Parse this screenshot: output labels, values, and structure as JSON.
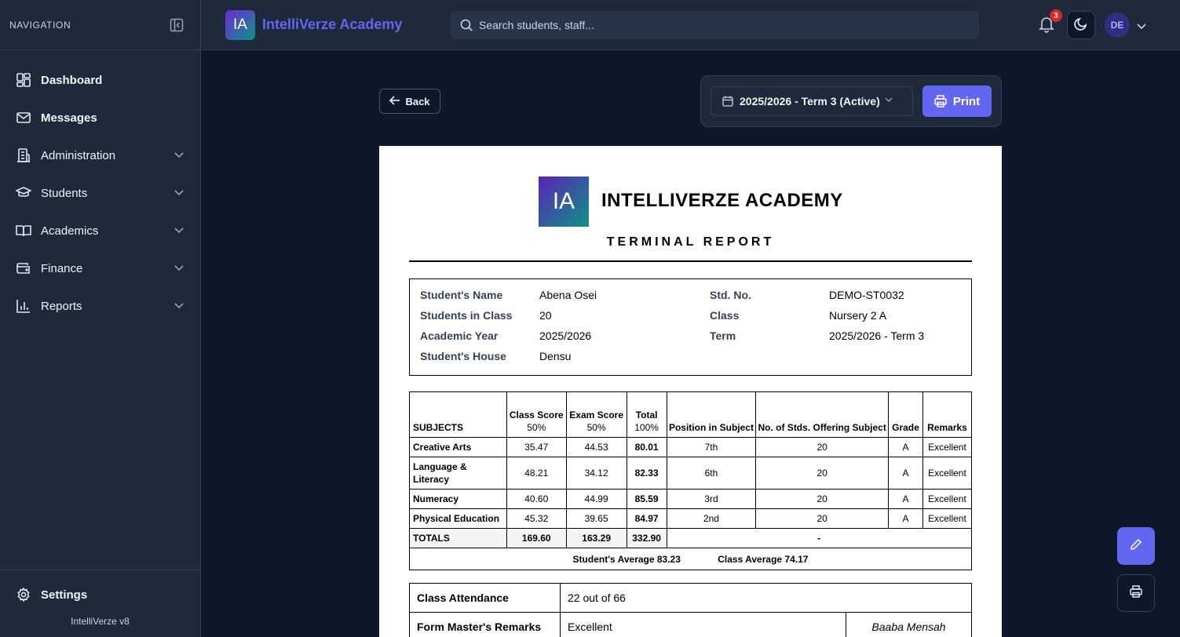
{
  "sidebar": {
    "nav_label": "NAVIGATION",
    "items": [
      {
        "label": "Dashboard",
        "icon": "dashboard-icon"
      },
      {
        "label": "Messages",
        "icon": "mail-icon"
      },
      {
        "label": "Administration",
        "icon": "building-icon"
      },
      {
        "label": "Students",
        "icon": "graduation-cap-icon"
      },
      {
        "label": "Academics",
        "icon": "book-icon"
      },
      {
        "label": "Finance",
        "icon": "wallet-icon"
      },
      {
        "label": "Reports",
        "icon": "bar-chart-icon"
      }
    ],
    "settings_label": "Settings",
    "version": "IntelliVerze v8"
  },
  "topbar": {
    "logo_text": "IA",
    "brand": "IntelliVerze Academy",
    "search_placeholder": "Search students, staff...",
    "notification_count": "3",
    "avatar_initials": "DE"
  },
  "toolbar": {
    "back_label": "Back",
    "term_selected": "2025/2026 - Term 3 (Active)",
    "print_label": "Print"
  },
  "report": {
    "logo_text": "IA",
    "school_name": "INTELLIVERZE ACADEMY",
    "title": "TERMINAL REPORT",
    "info": {
      "name_label": "Student's Name",
      "name_value": "Abena Osei",
      "stdno_label": "Std. No.",
      "stdno_value": "DEMO-ST0032",
      "inclass_label": "Students in Class",
      "inclass_value": "20",
      "class_label": "Class",
      "class_value": "Nursery 2 A",
      "year_label": "Academic Year",
      "year_value": "2025/2026",
      "term_label": "Term",
      "term_value": "2025/2026 - Term 3",
      "house_label": "Student's House",
      "house_value": "Densu"
    },
    "headers": {
      "subjects": "SUBJECTS",
      "class_score": "Class Score",
      "class_score_pct": "50%",
      "exam_score": "Exam Score",
      "exam_score_pct": "50%",
      "total": "Total",
      "total_pct": "100%",
      "position": "Position in Subject",
      "num_offering": "No. of Stds. Offering Subject",
      "grade": "Grade",
      "remarks": "Remarks"
    },
    "rows": [
      {
        "subject": "Creative Arts",
        "class": "35.47",
        "exam": "44.53",
        "total": "80.01",
        "position": "7th",
        "count": "20",
        "grade": "A",
        "remark": "Excellent"
      },
      {
        "subject": "Language & Literacy",
        "class": "48.21",
        "exam": "34.12",
        "total": "82.33",
        "position": "6th",
        "count": "20",
        "grade": "A",
        "remark": "Excellent"
      },
      {
        "subject": "Numeracy",
        "class": "40.60",
        "exam": "44.99",
        "total": "85.59",
        "position": "3rd",
        "count": "20",
        "grade": "A",
        "remark": "Excellent"
      },
      {
        "subject": "Physical Education",
        "class": "45.32",
        "exam": "39.65",
        "total": "84.97",
        "position": "2nd",
        "count": "20",
        "grade": "A",
        "remark": "Excellent"
      }
    ],
    "totals": {
      "label": "TOTALS",
      "class": "169.60",
      "exam": "163.29",
      "total": "332.90",
      "rest": "-"
    },
    "student_average": "Student's Average 83.23",
    "class_average": "Class Average 74.17",
    "attendance_label": "Class Attendance",
    "attendance_value": "22 out of 66",
    "form_master_label": "Form Master's Remarks",
    "form_master_value": "Excellent",
    "form_master_signature": "Baaba Mensah"
  },
  "colors": {
    "accent": "#6366f1",
    "background": "#0f172a",
    "panel": "#1e293b",
    "badge": "#dc2626"
  }
}
